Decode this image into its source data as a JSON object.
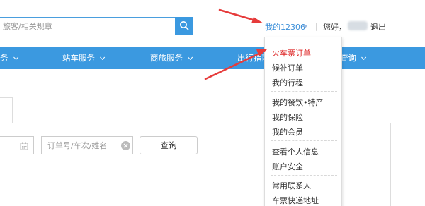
{
  "header": {
    "search_placeholder": "旅客/相关规章",
    "my12306_label": "我的12306",
    "separator": "|",
    "greeting": "您好，",
    "logout_label": "退出"
  },
  "nav": {
    "items": [
      {
        "label": "务"
      },
      {
        "label": "站车服务"
      },
      {
        "label": "商旅服务"
      },
      {
        "label": "出行指南"
      },
      {
        "label": "查询"
      }
    ]
  },
  "dropdown": {
    "items": [
      "火车票订单",
      "候补订单",
      "我的行程",
      "我的餐饮•特产",
      "我的保险",
      "我的会员",
      "查看个人信息",
      "账户安全",
      "常用联系人",
      "车票快递地址"
    ]
  },
  "filters": {
    "order_placeholder": "订单号/车次/姓名",
    "query_label": "查询"
  },
  "colors": {
    "nav_blue": "#3b99e0",
    "link_blue": "#3b8fd9",
    "active_red": "#d22222",
    "arrow_red": "#e63b3b"
  },
  "icons": {
    "search": "search-icon",
    "calendar": "calendar-icon",
    "clear": "clear-icon",
    "caret": "caret-down-icon",
    "nav_chevron": "chevron-down-icon"
  }
}
